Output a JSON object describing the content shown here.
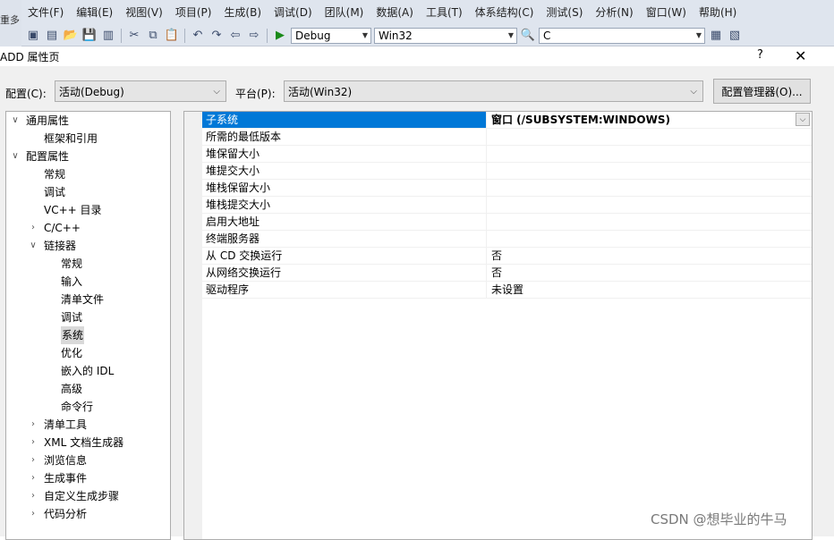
{
  "ide": {
    "left_text": "重多",
    "menu": [
      "文件(F)",
      "编辑(E)",
      "视图(V)",
      "项目(P)",
      "生成(B)",
      "调试(D)",
      "团队(M)",
      "数据(A)",
      "工具(T)",
      "体系结构(C)",
      "测试(S)",
      "分析(N)",
      "窗口(W)",
      "帮助(H)"
    ],
    "toolbar": {
      "config_value": "Debug",
      "platform_value": "Win32",
      "search_value": "C"
    }
  },
  "dialog": {
    "title": "ADD 属性页",
    "help_label": "?",
    "close_label": "✕",
    "config_label": "配置(C):",
    "config_value": "活动(Debug)",
    "platform_label": "平台(P):",
    "platform_value": "活动(Win32)",
    "manager_button": "配置管理器(O)..."
  },
  "tree": [
    {
      "label": "通用属性",
      "level": 0,
      "toggle": "expanded"
    },
    {
      "label": "框架和引用",
      "level": 1,
      "toggle": "none"
    },
    {
      "label": "配置属性",
      "level": 0,
      "toggle": "expanded"
    },
    {
      "label": "常规",
      "level": 1,
      "toggle": "none"
    },
    {
      "label": "调试",
      "level": 1,
      "toggle": "none"
    },
    {
      "label": "VC++ 目录",
      "level": 1,
      "toggle": "none"
    },
    {
      "label": "C/C++",
      "level": 1,
      "toggle": "collapsed"
    },
    {
      "label": "链接器",
      "level": 1,
      "toggle": "expanded"
    },
    {
      "label": "常规",
      "level": 2,
      "toggle": "none"
    },
    {
      "label": "输入",
      "level": 2,
      "toggle": "none"
    },
    {
      "label": "清单文件",
      "level": 2,
      "toggle": "none"
    },
    {
      "label": "调试",
      "level": 2,
      "toggle": "none"
    },
    {
      "label": "系统",
      "level": 2,
      "toggle": "none",
      "selected": true
    },
    {
      "label": "优化",
      "level": 2,
      "toggle": "none"
    },
    {
      "label": "嵌入的 IDL",
      "level": 2,
      "toggle": "none"
    },
    {
      "label": "高级",
      "level": 2,
      "toggle": "none"
    },
    {
      "label": "命令行",
      "level": 2,
      "toggle": "none"
    },
    {
      "label": "清单工具",
      "level": 1,
      "toggle": "collapsed"
    },
    {
      "label": "XML 文档生成器",
      "level": 1,
      "toggle": "collapsed"
    },
    {
      "label": "浏览信息",
      "level": 1,
      "toggle": "collapsed"
    },
    {
      "label": "生成事件",
      "level": 1,
      "toggle": "collapsed"
    },
    {
      "label": "自定义生成步骤",
      "level": 1,
      "toggle": "collapsed"
    },
    {
      "label": "代码分析",
      "level": 1,
      "toggle": "collapsed"
    }
  ],
  "properties": [
    {
      "name": "子系统",
      "value": "窗口 (/SUBSYSTEM:WINDOWS)",
      "selected": true
    },
    {
      "name": "所需的最低版本",
      "value": ""
    },
    {
      "name": "堆保留大小",
      "value": ""
    },
    {
      "name": "堆提交大小",
      "value": ""
    },
    {
      "name": "堆栈保留大小",
      "value": ""
    },
    {
      "name": "堆栈提交大小",
      "value": ""
    },
    {
      "name": "启用大地址",
      "value": ""
    },
    {
      "name": "终端服务器",
      "value": ""
    },
    {
      "name": "从 CD 交换运行",
      "value": "否"
    },
    {
      "name": "从网络交换运行",
      "value": "否"
    },
    {
      "name": "驱动程序",
      "value": "未设置"
    }
  ],
  "watermark": "CSDN @想毕业的牛马"
}
